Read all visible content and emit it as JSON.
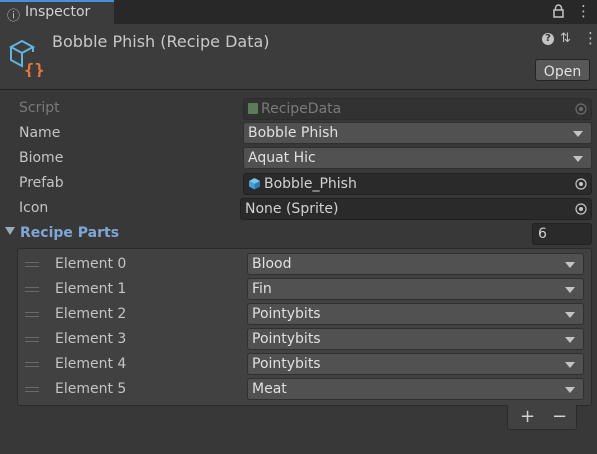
{
  "window": {
    "tab_icon": "info-icon",
    "tab_label": "Inspector",
    "lock_icon": "lock-icon",
    "menu_icon": "kebab-menu-icon"
  },
  "header": {
    "asset_icon": "scriptable-object-icon",
    "title": "Bobble Phish (Recipe Data)",
    "help_icon": "help-icon",
    "presets_icon": "presets-icon",
    "menu_icon": "kebab-menu-icon",
    "open_label": "Open"
  },
  "fields": {
    "script": {
      "label": "Script",
      "value": "RecipeData"
    },
    "name": {
      "label": "Name",
      "value": "Bobble Phish"
    },
    "biome": {
      "label": "Biome",
      "value": "Aquat Hic"
    },
    "prefab": {
      "label": "Prefab",
      "value": "Bobble_Phish"
    },
    "icon": {
      "label": "Icon",
      "value": "None (Sprite)"
    }
  },
  "recipe_parts": {
    "label": "Recipe Parts",
    "size": "6",
    "elements": [
      {
        "label": "Element 0",
        "value": "Blood"
      },
      {
        "label": "Element 1",
        "value": "Fin"
      },
      {
        "label": "Element 2",
        "value": "Pointybits"
      },
      {
        "label": "Element 3",
        "value": "Pointybits"
      },
      {
        "label": "Element 4",
        "value": "Pointybits"
      },
      {
        "label": "Element 5",
        "value": "Meat"
      }
    ],
    "add_label": "+",
    "remove_label": "−"
  },
  "colors": {
    "background": "#383838",
    "header": "#3c3c3c",
    "accent": "#7fa6d6",
    "tab_highlight": "#4a90d9"
  }
}
